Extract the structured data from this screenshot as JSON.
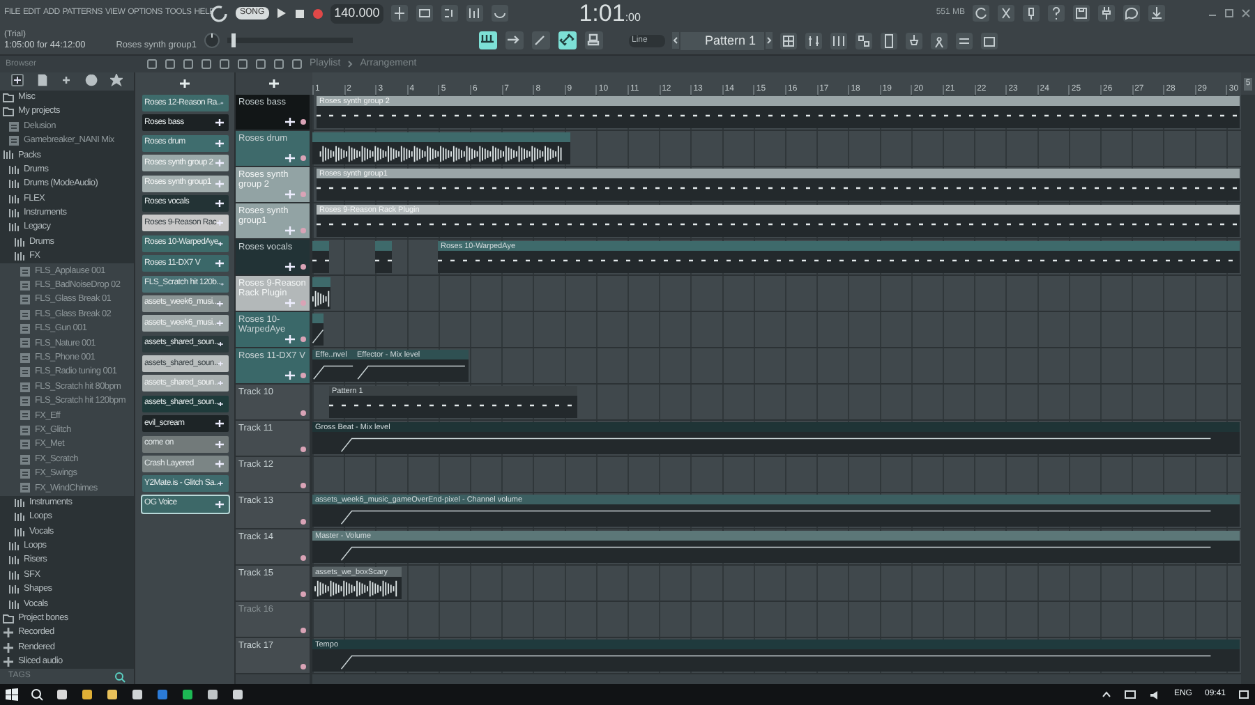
{
  "menu": [
    "FILE",
    "EDIT",
    "ADD",
    "PATTERNS",
    "VIEW",
    "OPTIONS",
    "TOOLS",
    "HELP"
  ],
  "transport": {
    "mode": "SONG",
    "tempo": "140.000",
    "time": "1:01",
    "time_sub": ":00",
    "memory": "551 MB"
  },
  "hint": {
    "status": "(Trial)",
    "range": "1:05:00 for 44:12:00",
    "selection": "Roses synth group1"
  },
  "master_slider": {
    "level": 0.03
  },
  "tools": [
    {
      "selected": true
    },
    {
      "selected": false
    },
    {
      "selected": false
    },
    {
      "selected": true
    },
    {
      "selected": false
    }
  ],
  "snap": "Line",
  "pattern": "Pattern 1",
  "breadcrumb": [
    "Playlist",
    "Arrangement"
  ],
  "browser": {
    "title": "Browser",
    "footer": "TAGS",
    "tree": [
      {
        "label": "Misc",
        "kind": "folder"
      },
      {
        "label": "My projects",
        "kind": "folder",
        "children": [
          {
            "label": "Delusion",
            "kind": "file"
          },
          {
            "label": "Gamebreaker_NANI Mix",
            "kind": "file"
          }
        ]
      },
      {
        "label": "Packs",
        "kind": "pack",
        "children": [
          {
            "label": "Drums",
            "kind": "pack"
          },
          {
            "label": "Drums (ModeAudio)",
            "kind": "pack"
          },
          {
            "label": "FLEX",
            "kind": "pack"
          },
          {
            "label": "Instruments",
            "kind": "pack"
          },
          {
            "label": "Legacy",
            "kind": "pack",
            "children": [
              {
                "label": "Drums",
                "kind": "pack"
              },
              {
                "label": "FX",
                "kind": "pack",
                "children": [
                  {
                    "label": "FLS_Applause 001",
                    "kind": "file"
                  },
                  {
                    "label": "FLS_BadNoiseDrop 02",
                    "kind": "file"
                  },
                  {
                    "label": "FLS_Glass Break 01",
                    "kind": "file"
                  },
                  {
                    "label": "FLS_Glass Break 02",
                    "kind": "file"
                  },
                  {
                    "label": "FLS_Gun 001",
                    "kind": "file"
                  },
                  {
                    "label": "FLS_Nature 001",
                    "kind": "file"
                  },
                  {
                    "label": "FLS_Phone 001",
                    "kind": "file"
                  },
                  {
                    "label": "FLS_Radio tuning 001",
                    "kind": "file"
                  },
                  {
                    "label": "FLS_Scratch hit 80bpm",
                    "kind": "file"
                  },
                  {
                    "label": "FLS_Scratch hit 120bpm",
                    "kind": "file"
                  },
                  {
                    "label": "FX_Eff",
                    "kind": "file"
                  },
                  {
                    "label": "FX_Glitch",
                    "kind": "file"
                  },
                  {
                    "label": "FX_Met",
                    "kind": "file"
                  },
                  {
                    "label": "FX_Scratch",
                    "kind": "file"
                  },
                  {
                    "label": "FX_Swings",
                    "kind": "file"
                  },
                  {
                    "label": "FX_WindChimes",
                    "kind": "file"
                  }
                ]
              },
              {
                "label": "Instruments",
                "kind": "pack"
              },
              {
                "label": "Loops",
                "kind": "pack"
              },
              {
                "label": "Vocals",
                "kind": "pack"
              }
            ]
          },
          {
            "label": "Loops",
            "kind": "pack"
          },
          {
            "label": "Risers",
            "kind": "pack"
          },
          {
            "label": "SFX",
            "kind": "pack"
          },
          {
            "label": "Shapes",
            "kind": "pack"
          },
          {
            "label": "Vocals",
            "kind": "pack"
          }
        ]
      },
      {
        "label": "Project bones",
        "kind": "folder"
      },
      {
        "label": "Recorded",
        "kind": "special"
      },
      {
        "label": "Rendered",
        "kind": "special"
      },
      {
        "label": "Sliced audio",
        "kind": "special"
      }
    ]
  },
  "channels": [
    {
      "name": "Roses 12-Reason Ra..",
      "color": "#3e6b6b",
      "selected": false
    },
    {
      "name": "Roses bass",
      "color": "#1c2224",
      "selected": false
    },
    {
      "name": "Roses drum",
      "color": "#3f6d6e",
      "selected": false
    },
    {
      "name": "Roses synth group 2",
      "color": "#9aa9a9",
      "selected": false
    },
    {
      "name": "Roses synth group1",
      "color": "#a2aeae",
      "selected": false
    },
    {
      "name": "Roses vocals",
      "color": "#233335",
      "selected": false
    },
    {
      "name": "Roses 9-Reason Rac",
      "color": "#c8c8c8",
      "selected": false
    },
    {
      "name": "Roses 10-WarpedAye",
      "color": "#3d6b6a",
      "selected": false
    },
    {
      "name": "Roses 11-DX7 V",
      "color": "#3b6869",
      "selected": false
    },
    {
      "name": "FLS_Scratch hit 120b..",
      "color": "#4a7275",
      "selected": false
    },
    {
      "name": "assets_week6_musi..",
      "color": "#8a9494",
      "selected": false
    },
    {
      "name": "assets_week6_musi..",
      "color": "#9fa9a9",
      "selected": false
    },
    {
      "name": "assets_shared_soun..",
      "color": "#2b3a3c",
      "selected": false
    },
    {
      "name": "assets_shared_soun..",
      "color": "#b9bebe",
      "selected": false
    },
    {
      "name": "assets_shared_soun..",
      "color": "#a9b0b0",
      "selected": false
    },
    {
      "name": "assets_shared_soun..",
      "color": "#1f3b3b",
      "selected": false
    },
    {
      "name": "evil_scream",
      "color": "#1d2426",
      "selected": false
    },
    {
      "name": "come on",
      "color": "#727a7a",
      "selected": false
    },
    {
      "name": "Crash Layered",
      "color": "#7b8585",
      "selected": false
    },
    {
      "name": "Y2Mate.is - Glitch Sa..",
      "color": "#3f6b6d",
      "selected": false
    },
    {
      "name": "OG Voice",
      "color": "#3d6868",
      "selected": true
    }
  ],
  "ruler": [
    "1",
    "2",
    "3",
    "4",
    "5",
    "6",
    "7",
    "8",
    "9",
    "10",
    "11",
    "12",
    "13",
    "14",
    "15",
    "16",
    "17",
    "18",
    "19",
    "20",
    "21",
    "22",
    "23",
    "24",
    "25",
    "26",
    "27",
    "28",
    "29",
    "30"
  ],
  "zoom_value": "5",
  "tracks": [
    {
      "name": "Roses bass",
      "color": "#121617",
      "clips": [
        {
          "kind": "pattern",
          "label": "Roses synth group 2",
          "color": "#9aa5a7"
        }
      ]
    },
    {
      "name": "Roses drum",
      "color": "#3e6a6b",
      "clips": [
        {
          "kind": "audio",
          "color": "#3e6a6b"
        }
      ]
    },
    {
      "name": "Roses synth group 2",
      "color": "#92a3a4",
      "clips": [
        {
          "kind": "pattern",
          "label": "Roses synth group1",
          "color": "#9aa5a7"
        }
      ]
    },
    {
      "name": "Roses synth group1",
      "color": "#92a3a4",
      "clips": [
        {
          "kind": "pattern",
          "label": "Roses 9-Reason Rack Plugin",
          "color": "#b5bcbd"
        }
      ]
    },
    {
      "name": "Roses vocals",
      "color": "#223336",
      "clips": [
        {
          "kind": "pattern",
          "color": "#3e6a6b"
        },
        {
          "kind": "pattern",
          "color": "#3e6a6b"
        },
        {
          "kind": "pattern",
          "label": "Roses 10-WarpedAye",
          "color": "#3e6a6b"
        }
      ]
    },
    {
      "name": "Roses 9-Reason Rack Plugin",
      "color": "#b3b8b9",
      "clips": [
        {
          "kind": "audio",
          "color": "#3e6a6b"
        }
      ]
    },
    {
      "name": "Roses 10-WarpedAye",
      "color": "#3a6869",
      "clips": [
        {
          "kind": "automation",
          "color": "#3e6a6b"
        }
      ]
    },
    {
      "name": "Roses 11-DX7 V",
      "color": "#3a6869",
      "clips": [
        {
          "kind": "automation",
          "label": "Effe..nvel",
          "color": "#2f5052"
        },
        {
          "kind": "automation",
          "label": "Effector - Mix level",
          "color": "#2f5052"
        }
      ]
    },
    {
      "name": "Track 10",
      "color": "#454c50",
      "clips": [
        {
          "kind": "pattern",
          "label": "Pattern 1",
          "color": "#3a4144"
        }
      ]
    },
    {
      "name": "Track 11",
      "color": "#454c50",
      "clips": [
        {
          "kind": "automation",
          "label": "Gross Beat - Mix level",
          "color": "#1f3436"
        }
      ]
    },
    {
      "name": "Track 12",
      "color": "#454c50"
    },
    {
      "name": "Track 13",
      "color": "#454c50",
      "clips": [
        {
          "kind": "automation",
          "label": "assets_week6_music_gameOverEnd-pixel - Channel volume",
          "color": "#3c5f61"
        }
      ]
    },
    {
      "name": "Track 14",
      "color": "#454c50",
      "clips": [
        {
          "kind": "automation",
          "label": "Master - Volume",
          "color": "#5c7778"
        }
      ]
    },
    {
      "name": "Track 15",
      "color": "#454c50",
      "clips": [
        {
          "kind": "audio",
          "label": "assets_we_boxScary",
          "color": "#5a6467"
        }
      ]
    },
    {
      "name": "Track 16",
      "color": "#454c50",
      "dim": true
    },
    {
      "name": "Track 17",
      "color": "#454c50",
      "clips": [
        {
          "kind": "automation",
          "label": "Tempo",
          "color": "#1f3a3d"
        }
      ]
    }
  ],
  "taskbar": {
    "language": "ENG",
    "clock": "09:41"
  }
}
